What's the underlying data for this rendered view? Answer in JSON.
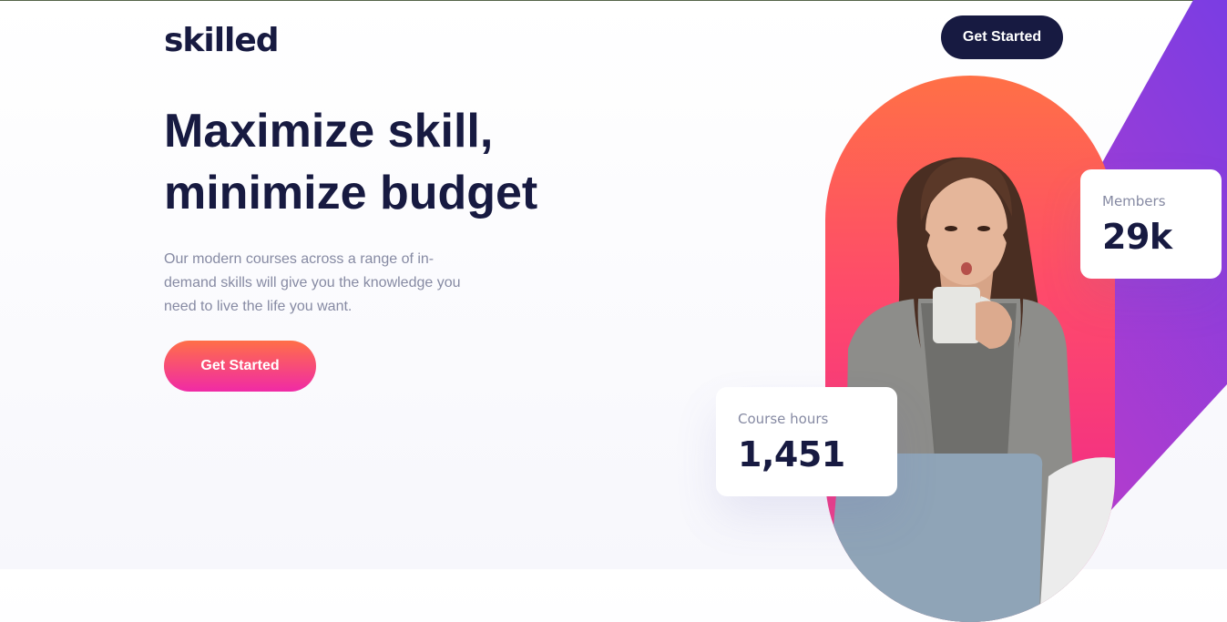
{
  "header": {
    "logo": "skilled",
    "cta_label": "Get Started"
  },
  "hero": {
    "title_line1": "Maximize skill,",
    "title_line2": "minimize budget",
    "description": "Our modern courses across a range of in-demand skills will give you the knowledge you need to live the life you want.",
    "cta_label": "Get Started"
  },
  "stats": {
    "members": {
      "label": "Members",
      "value": "29k"
    },
    "course_hours": {
      "label": "Course hours",
      "value": "1,451"
    }
  },
  "colors": {
    "navy": "#171a41",
    "muted_text": "#868aa3",
    "gradient_orange": "#ff6f48",
    "gradient_pink": "#f02aa6",
    "accent_purple": "#7a3de3",
    "accent_magenta": "#c83fc8"
  },
  "image": {
    "subject": "hero-photo-woman-with-mug"
  }
}
